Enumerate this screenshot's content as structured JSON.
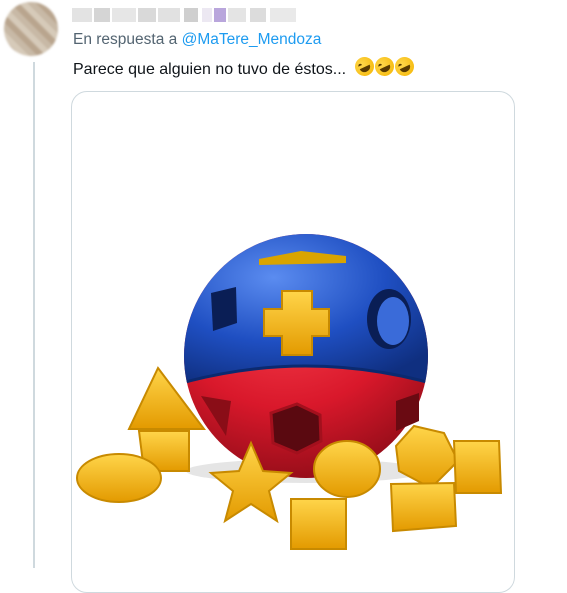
{
  "tweet": {
    "reply_prefix": "En respuesta a",
    "reply_handle": "@MaTere_Mendoza",
    "text": "Parece que alguien no tuvo de éstos...",
    "emojis": [
      "rolling-on-floor-laughing-icon",
      "rolling-on-floor-laughing-icon",
      "rolling-on-floor-laughing-icon"
    ]
  },
  "colors": {
    "link": "#1d9bf0",
    "secondary_text": "#536471",
    "primary_text": "#0f1419",
    "toy_blue": "#1f4fc2",
    "toy_red": "#d9182b",
    "toy_yellow": "#f5b512"
  }
}
